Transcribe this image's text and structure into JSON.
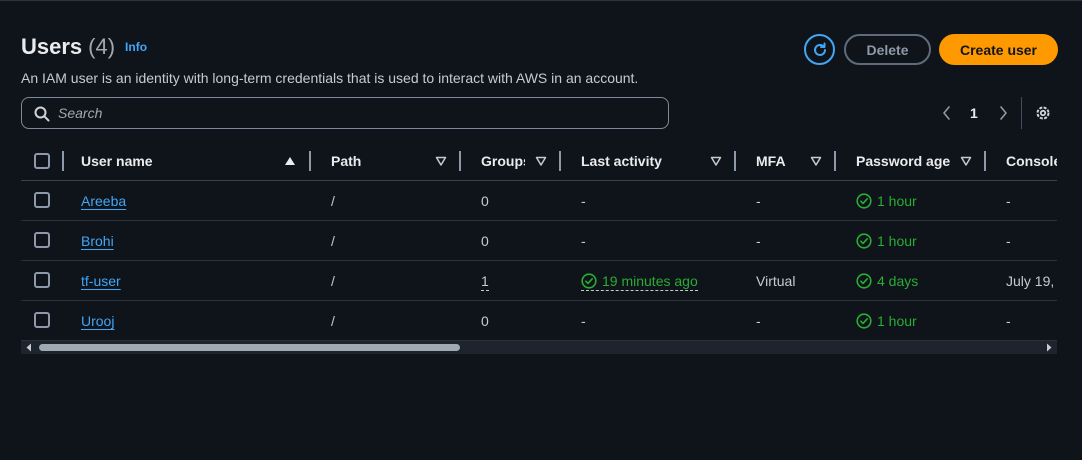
{
  "header": {
    "title": "Users",
    "count": "(4)",
    "info": "Info",
    "description": "An IAM user is an identity with long-term credentials that is used to interact with AWS in an account.",
    "delete_label": "Delete",
    "create_label": "Create user"
  },
  "search": {
    "placeholder": "Search",
    "value": ""
  },
  "pagination": {
    "current_page": "1"
  },
  "table": {
    "columns": [
      "User name",
      "Path",
      "Groups",
      "Last activity",
      "MFA",
      "Password age",
      "Console"
    ],
    "rows": [
      {
        "user": "Areeba",
        "path": "/",
        "groups": "0",
        "last_activity": "-",
        "mfa": "-",
        "password_age": "1 hour",
        "console": "-"
      },
      {
        "user": "Brohi",
        "path": "/",
        "groups": "0",
        "last_activity": "-",
        "mfa": "-",
        "password_age": "1 hour",
        "console": "-"
      },
      {
        "user": "tf-user",
        "path": "/",
        "groups": "1",
        "last_activity": "19 minutes ago",
        "mfa": "Virtual",
        "password_age": "4 days",
        "console": "July 19,"
      },
      {
        "user": "Urooj",
        "path": "/",
        "groups": "0",
        "last_activity": "-",
        "mfa": "-",
        "password_age": "1 hour",
        "console": "-"
      }
    ]
  },
  "colors": {
    "background": "#0f141a",
    "link": "#42a5f5",
    "primary_button": "#ff9900",
    "success": "#29ad32"
  },
  "icons": [
    "refresh-icon",
    "search-icon",
    "chevron-left-icon",
    "chevron-right-icon",
    "settings-icon",
    "sort-ascending-icon",
    "sort-descending-icon",
    "status-ok-icon"
  ]
}
